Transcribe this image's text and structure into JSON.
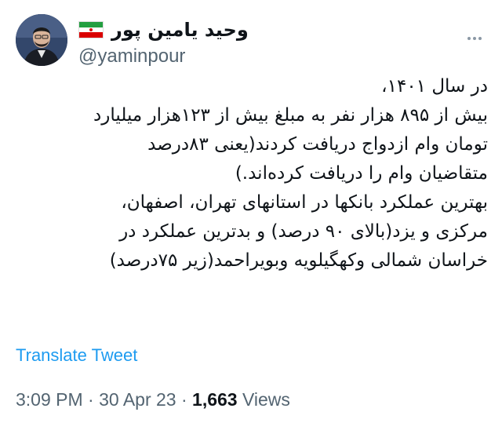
{
  "author": {
    "display_name": "وحید یامین پور",
    "handle": "@yaminpour",
    "flag_icon": "iran-flag-icon",
    "avatar_icon": "profile-photo"
  },
  "tweet": {
    "lines": [
      "در سال ۱۴۰۱،",
      "بیش از ۸۹۵ هزار نفر به مبلغ بیش از ۱۲۳هزار میلیارد",
      "تومان وام ازدواج دریافت کردند(یعنی ۸۳درصد",
      "متقاضیان وام را دریافت کرده‌اند.)",
      "بهترین عملکرد بانکها در استانهای تهران، اصفهان،",
      "مرکزی و یزد(بالای ۹۰ درصد) و بدترین عملکرد در",
      "خراسان شمالی وکهگیلویه وبویراحمد(زیر ۷۵درصد)"
    ],
    "translate_label": "Translate Tweet"
  },
  "meta": {
    "time": "3:09 PM",
    "separator": "·",
    "date": "30 Apr 23",
    "views_count": "1,663",
    "views_label": "Views"
  },
  "colors": {
    "link": "#1d9bf0",
    "secondary_text": "#536471",
    "primary_text": "#0f1419"
  }
}
